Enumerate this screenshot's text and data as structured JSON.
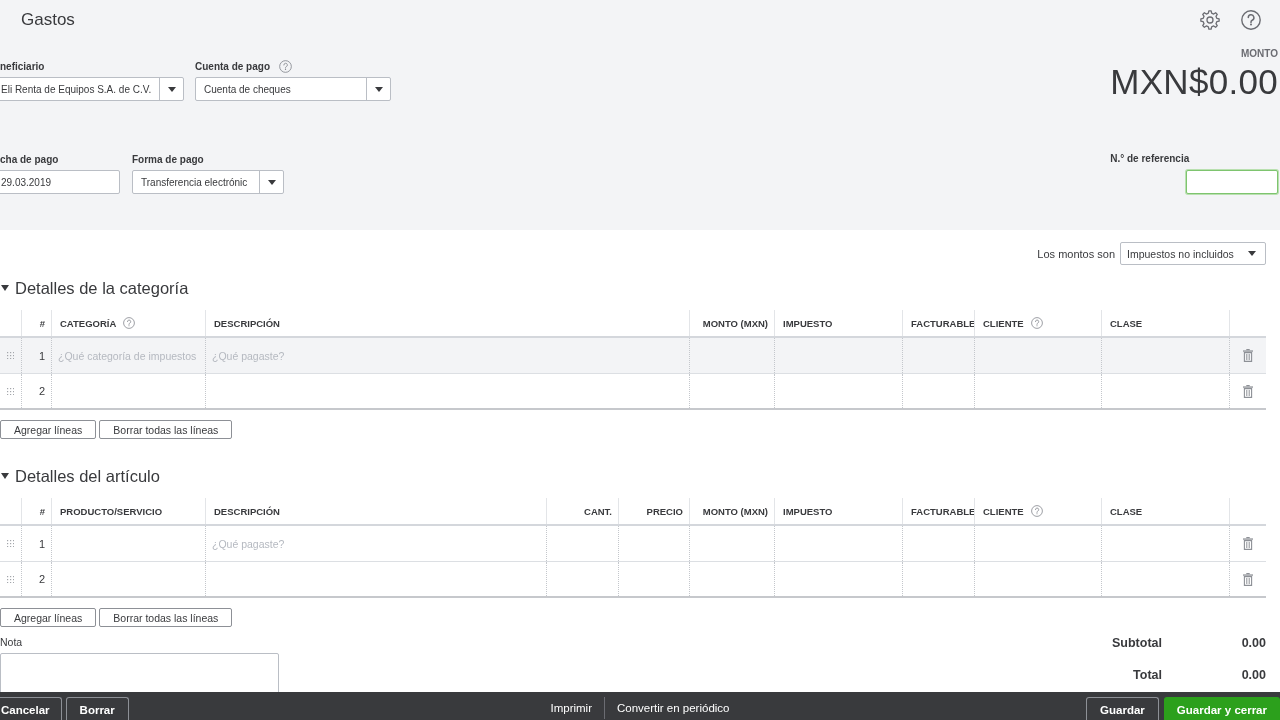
{
  "header": {
    "title": "Gastos",
    "amount_label": "MONTO",
    "amount": "MXN$0.00"
  },
  "field_rows": [
    [
      {
        "label": "neficiario",
        "value": "Eli Renta de Equipos S.A. de C.V.",
        "kind": "dropdown",
        "help": false
      },
      {
        "label": "Cuenta de pago",
        "value": "Cuenta de cheques",
        "kind": "dropdown",
        "help": true
      }
    ],
    [
      {
        "label": "cha de pago",
        "value": "29.03.2019",
        "kind": "text",
        "help": false
      },
      {
        "label": "Forma de pago",
        "value": "Transferencia electrónic",
        "kind": "dropdown",
        "help": false
      }
    ]
  ],
  "reference": {
    "label": "N.° de referencia",
    "focused": true
  },
  "amounts_mode": {
    "label": "Los montos son",
    "value": "Impuestos no incluidos"
  },
  "sections": [
    {
      "title": "Detalles de la categoría",
      "expanded": true,
      "columns": [
        {
          "label": "#",
          "kind": "number",
          "help": false
        },
        {
          "label": "CATEGORÍA",
          "kind": "category",
          "help": true
        },
        {
          "label": "DESCRIPCIÓN",
          "kind": "description",
          "help": false
        },
        {
          "label": "MONTO (MXN)",
          "kind": "amount",
          "help": false
        },
        {
          "label": "IMPUESTO",
          "kind": "tax",
          "help": false
        },
        {
          "label": "FACTURABLE",
          "kind": "billable",
          "help": false
        },
        {
          "label": "CLIENTE",
          "kind": "customer",
          "help": true
        },
        {
          "label": "CLASE",
          "kind": "class",
          "help": false
        }
      ],
      "rows": [
        {
          "number": "1",
          "highlighted": true,
          "placeholders": [
            {
              "kind": "category",
              "text": "¿Qué categoría de impuestos"
            },
            {
              "kind": "description",
              "text": "¿Qué pagaste?"
            }
          ]
        },
        {
          "number": "2",
          "highlighted": false
        }
      ],
      "buttons": [
        "Agregar líneas",
        "Borrar todas las líneas"
      ]
    },
    {
      "title": "Detalles del artículo",
      "expanded": true,
      "columns": [
        {
          "label": "#",
          "kind": "number",
          "help": false
        },
        {
          "label": "PRODUCTO/SERVICIO",
          "kind": "product",
          "help": false
        },
        {
          "label": "DESCRIPCIÓN",
          "kind": "description",
          "help": false
        },
        {
          "label": "CANT.",
          "kind": "qty",
          "help": false
        },
        {
          "label": "PRECIO",
          "kind": "price",
          "help": false
        },
        {
          "label": "MONTO (MXN)",
          "kind": "amount",
          "help": false
        },
        {
          "label": "IMPUESTO",
          "kind": "tax",
          "help": false
        },
        {
          "label": "FACTURABLE",
          "kind": "billable",
          "help": false
        },
        {
          "label": "CLIENTE",
          "kind": "customer",
          "help": true
        },
        {
          "label": "CLASE",
          "kind": "class",
          "help": false
        }
      ],
      "rows": [
        {
          "number": "1",
          "highlighted": false,
          "placeholders": [
            {
              "kind": "description",
              "text": "¿Qué pagaste?"
            }
          ]
        },
        {
          "number": "2",
          "highlighted": false
        }
      ],
      "buttons": [
        "Agregar líneas",
        "Borrar todas las líneas"
      ]
    }
  ],
  "note": {
    "label": "Nota"
  },
  "totals": [
    {
      "label": "Subtotal",
      "value": "0.00"
    },
    {
      "label": "Total",
      "value": "0.00"
    }
  ],
  "footer": {
    "left_buttons": [
      "Cancelar",
      "Borrar"
    ],
    "links": [
      "Imprimir",
      "Convertir en periódico"
    ],
    "right_buttons": [
      {
        "label": "Guardar",
        "kind": "secondary"
      },
      {
        "label": "Guardar y cerrar",
        "kind": "primary"
      }
    ]
  }
}
